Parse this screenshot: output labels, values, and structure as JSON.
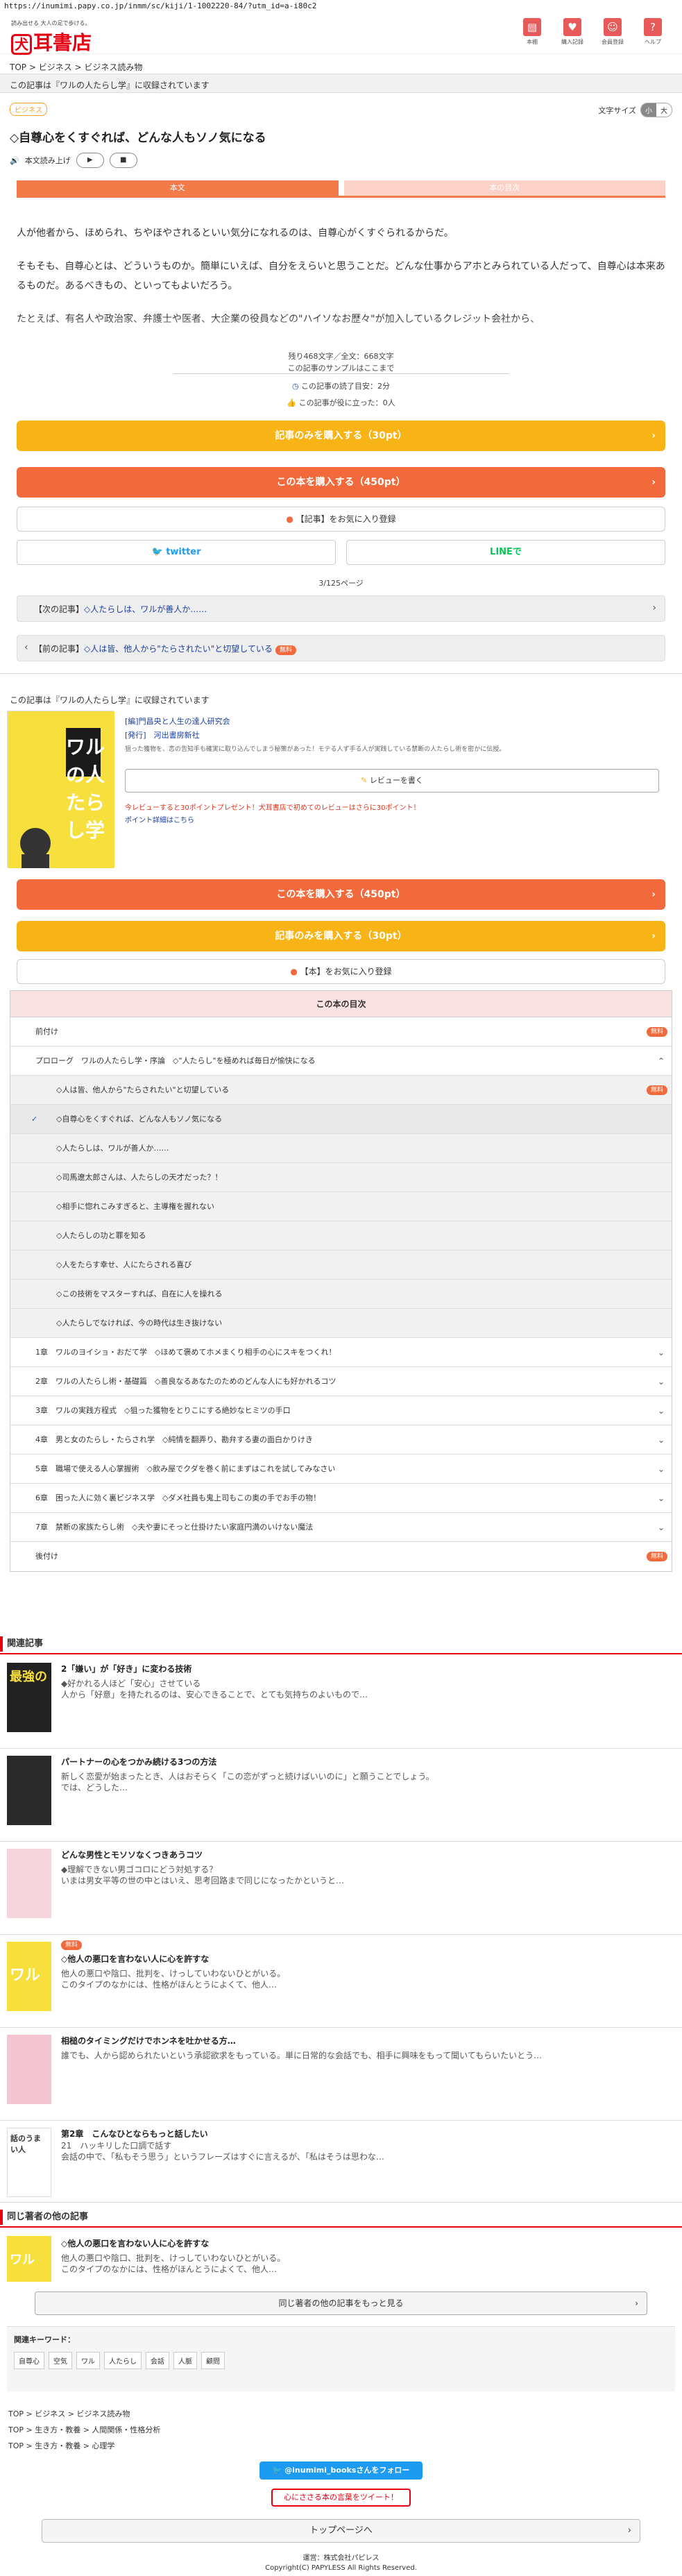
{
  "url": "https://inumimi.papy.co.jp/inmm/sc/kiji/1-1002220-84/?utm_id=a-i80c2",
  "header": {
    "tagline": "読み出せる 大人の足で歩ける。",
    "logo_mark": "犬",
    "logo_text": "耳書店",
    "icons": [
      {
        "label": "本棚",
        "icon": "book-icon"
      },
      {
        "label": "購入記録",
        "icon": "heart-icon"
      },
      {
        "label": "会員登録",
        "icon": "user-icon"
      },
      {
        "label": "ヘルプ",
        "icon": "help-icon"
      }
    ]
  },
  "breadcrumb": "TOP > ビジネス > ビジネス読み物",
  "stored_in": "この記事は『ワルの人たらし学』に収録されています",
  "category_badge": "ビジネス",
  "font_size": {
    "label": "文字サイズ",
    "small": "小",
    "large": "大"
  },
  "article": {
    "title": "◇自尊心をくすぐれば、どんな人もソノ気になる",
    "tts_label": "本文読み上げ",
    "tabs": [
      "本文",
      "本の目次"
    ],
    "paragraphs": [
      "人が他者から、ほめられ、ちやほやされるといい気分になれるのは、自尊心がくすぐられるからだ。",
      "そもそも、自尊心とは、どういうものか。簡単にいえば、自分をえらいと思うことだ。どんな仕事からアホとみられている人だって、自尊心は本来あるものだ。あるべきもの、といってもよいだろう。",
      "たとえば、有名人や政治家、弁護士や医者、大企業の役員などの\"ハイソなお歴々\"が加入しているクレジット会社から、"
    ],
    "char_count": "残り468文字／全文：668文字",
    "sample_end": "この記事のサンプルはここまで",
    "read_time": "この記事の読了目安：2分",
    "helpful": "この記事が役に立った：0人"
  },
  "buttons": {
    "buy_article": "記事のみを購入する（30pt）",
    "buy_book": "この本を購入する（450pt）",
    "fav_article": "【記事】をお気に入り登録",
    "twitter": "twitter",
    "line": "LINEで"
  },
  "pages": "3/125ページ",
  "next_article": {
    "prefix": "【次の記事】",
    "title": "◇人たらしは、ワルが善人か……"
  },
  "prev_article": {
    "prefix": "【前の記事】",
    "title": "◇人は皆、他人から\"たらされたい\"と切望している",
    "badge": "無料"
  },
  "book": {
    "stored_in": "この記事は『ワルの人たらし学』に収録されています",
    "cover_title": "ワルの人たらし学",
    "author": "[編]門昌央と人生の達人研究会",
    "publisher": "[発行]　河出書房新社",
    "desc": "狙った獲物を、恋の告知手も確実に取り込んでしまう秘策があった！モテる人ず手る人が実践している禁断の人たらし術を密かに伝授。",
    "review_btn": "レビューを書く",
    "campaign1": "今レビューすると30ポイントプレゼント！犬耳書店で初めてのレビューはさらに30ポイント！",
    "campaign2": "ポイント詳細はこちら",
    "buy_book": "この本を購入する（450pt）",
    "buy_article": "記事のみを購入する（30pt）",
    "fav_book": "【本】をお気に入り登録"
  },
  "toc": {
    "heading": "この本の目次",
    "rows": [
      {
        "text": "前付け",
        "badge": "無料",
        "type": "main"
      },
      {
        "text": "プロローグ　ワルの人たらし学・序論　◇\"人たらし\"を極めれば毎日が愉快になる",
        "type": "main",
        "open": true
      },
      {
        "text": "◇人は皆、他人から\"たらされたい\"と切望している",
        "badge": "無料",
        "type": "sub"
      },
      {
        "text": "◇自尊心をくすぐれば、どんな人もソノ気になる",
        "type": "sub",
        "selected": true
      },
      {
        "text": "◇人たらしは、ワルが善人か……",
        "type": "sub"
      },
      {
        "text": "◇司馬遼太郎さんは、人たらしの天才だった？！",
        "type": "sub"
      },
      {
        "text": "◇相手に惚れこみすぎると、主導権を握れない",
        "type": "sub"
      },
      {
        "text": "◇人たらしの功と罪を知る",
        "type": "sub"
      },
      {
        "text": "◇人をたらす幸せ、人にたらされる喜び",
        "type": "sub"
      },
      {
        "text": "◇この技術をマスターすれば、自在に人を操れる",
        "type": "sub"
      },
      {
        "text": "◇人たらしでなければ、今の時代は生き抜けない",
        "type": "sub"
      },
      {
        "text": "1章　ワルのヨイショ・おだて学　◇ほめて褒めてホメまくり相手の心にスキをつくれ！",
        "type": "main"
      },
      {
        "text": "2章　ワルの人たらし術・基礎篇　◇善良なるあなたのためのどんな人にも好かれるコツ",
        "type": "main"
      },
      {
        "text": "3章　ワルの実践方程式　◇狙った獲物をとりこにする絶妙なヒミツの手口",
        "type": "main"
      },
      {
        "text": "4章　男と女のたらし・たらされ学　◇純情を翻弄り、勘弁する妻の面白かりけき",
        "type": "main"
      },
      {
        "text": "5章　職場で使える人心掌握術　◇飲み屋でクダを巻く前にまずはこれを試してみなさい",
        "type": "main"
      },
      {
        "text": "6章　困った人に効く裏ビジネス学　◇ダメ社員も鬼上司もこの奥の手でお手の物！",
        "type": "main"
      },
      {
        "text": "7章　禁断の家族たらし術　◇夫や妻にそっと仕掛けたい家庭円満のいけない魔法",
        "type": "main"
      },
      {
        "text": "後付け",
        "badge": "無料",
        "type": "main"
      }
    ]
  },
  "related": {
    "heading": "関連記事",
    "items": [
      {
        "title": "2「嫌い」が「好き」に変わる技術",
        "sub1": "◆好かれる人ほど「安心」させている",
        "sub2": "人から「好意」を持たれるのは、安心できることで、とても気持ちのよいもので…",
        "thumb_text": "最強の"
      },
      {
        "title": "パートナーの心をつかみ続ける3つの方法",
        "sub1": "新しく恋愛が始まったとき、人はおそらく「この恋がずっと続けばいいのに」と願うことでしょう。",
        "sub2": "では、どうした…"
      },
      {
        "title": "どんな男性とモソソなくつきあうコツ",
        "sub1": "◆理解できない男ゴコロにどう対処する？",
        "sub2": "いまは男女平等の世の中とはいえ、思考回路まで同じになったかというと…"
      },
      {
        "badge": "無料",
        "title": "◇他人の悪口を言わない人に心を許すな",
        "sub1": "他人の悪口や陰口、批判を、けっしていわないひとがいる。",
        "sub2": "このタイプのなかには、性格がほんとうによくて、他人…",
        "thumb_text": "ワル"
      },
      {
        "title": "相槌のタイミングだけでホンネを吐かせる方…",
        "sub1": "誰でも、人から認められたいという承認欲求をもっている。単に日常的な会話でも、相手に興味をもって聞いてもらいたいとう…"
      },
      {
        "title": "第2章　こんなひとならもっと話したい",
        "sub1": "21　ハッキリした口調で話す",
        "sub2": "会話の中で、「私もそう思う」というフレーズはすぐに言えるが、「私はそうは思わな…",
        "thumb_text": "話のうまい人"
      }
    ]
  },
  "same_series": {
    "heading": "同じ著者の他の記事",
    "item": {
      "title": "◇他人の悪口を言わない人に心を許すな",
      "sub1": "他人の悪口や陰口、批判を、けっしていわないひとがいる。",
      "sub2": "このタイプのなかには、性格がほんとうによくて、他人…",
      "thumb_text": "ワル"
    },
    "more_btn": "同じ著者の他の記事をもっと見る"
  },
  "keywords": {
    "label": "関連キーワード：",
    "items": [
      "自尊心",
      "空気",
      "ワル",
      "人たらし",
      "会話",
      "人脈",
      "顧問"
    ]
  },
  "footer_crumbs": [
    "TOP > ビジネス > ビジネス読み物",
    "TOP > 生き方・教養 > 人間関係・性格分析",
    "TOP > 生き方・教養 > 心理学"
  ],
  "follow": "@inumimi_booksさんをフォロー",
  "tweet": "心にささる本の言葉をツイート！",
  "top_btn": "トップページへ",
  "footer": [
    "運営：株式会社パピレス",
    "Copyright(C) PAPYLESS All Rights Reserved."
  ],
  "colors": {
    "brand_red": "#e60012",
    "yellow": "#f8b416",
    "orange": "#f26a3c",
    "link_blue": "#1a3ea0"
  }
}
